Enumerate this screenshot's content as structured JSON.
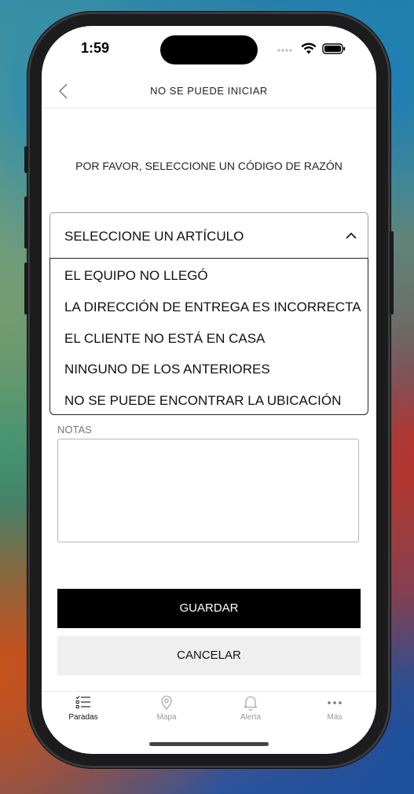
{
  "status_bar": {
    "time": "1:59"
  },
  "header": {
    "title": "NO SE PUEDE INICIAR",
    "back_icon": "chevron-left-icon"
  },
  "prompt": "POR FAVOR, SELECCIONE UN CÓDIGO DE RAZÓN",
  "reason_select": {
    "placeholder": "SELECCIONE UN ARTÍCULO",
    "expanded": true,
    "options": [
      "EL EQUIPO NO LLEGÓ",
      "LA DIRECCIÓN DE ENTREGA ES INCORRECTA",
      "EL CLIENTE NO ESTÁ EN CASA",
      "NINGUNO DE LOS ANTERIORES",
      "NO SE PUEDE ENCONTRAR LA UBICACIÓN"
    ]
  },
  "notes": {
    "label": "NOTAS",
    "value": ""
  },
  "actions": {
    "save_label": "GUARDAR",
    "cancel_label": "CANCELAR"
  },
  "tabbar": {
    "items": [
      {
        "label": "Paradas",
        "icon": "checklist-icon",
        "active": true
      },
      {
        "label": "Mapa",
        "icon": "map-pin-icon",
        "active": false
      },
      {
        "label": "Alerta",
        "icon": "bell-icon",
        "active": false
      },
      {
        "label": "Más",
        "icon": "more-dots-icon",
        "active": false
      }
    ]
  },
  "colors": {
    "primary_button": "#000000",
    "secondary_button": "#efefef",
    "active_tab": "#111111",
    "inactive_tab": "#999999"
  }
}
